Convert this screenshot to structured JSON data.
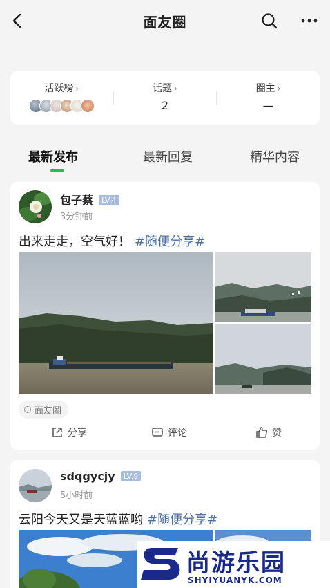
{
  "header": {
    "title": "面友圈",
    "back_icon": "chevron-left-icon",
    "search_icon": "search-icon",
    "more_icon": "more-horizontal-icon"
  },
  "stats": {
    "active": {
      "label": "活跃榜",
      "chev": "›"
    },
    "topics": {
      "label": "话题",
      "chev": "›",
      "value": "2"
    },
    "owner": {
      "label": "圈主",
      "chev": "›",
      "value": "—"
    }
  },
  "tabs": [
    {
      "label": "最新发布",
      "active": true
    },
    {
      "label": "最新回复",
      "active": false
    },
    {
      "label": "精华内容",
      "active": false
    }
  ],
  "accent_color": "#32b653",
  "posts": [
    {
      "author": "包子蔡",
      "level": "LV.4",
      "time": "3分钟前",
      "text": "出来走走，空气好！",
      "topic": "#随便分享#",
      "tag": "面友圈",
      "actions": {
        "share": "分享",
        "comment": "评论",
        "like": "赞"
      }
    },
    {
      "author": "sdqgycjy",
      "level": "LV.9",
      "time": "5小时前",
      "text": "云阳今天又是天蓝蓝哟",
      "topic": "#随便分享#"
    }
  ],
  "watermark": {
    "name": "尚游乐园",
    "domain": "SHYIYUANYK.COM"
  }
}
